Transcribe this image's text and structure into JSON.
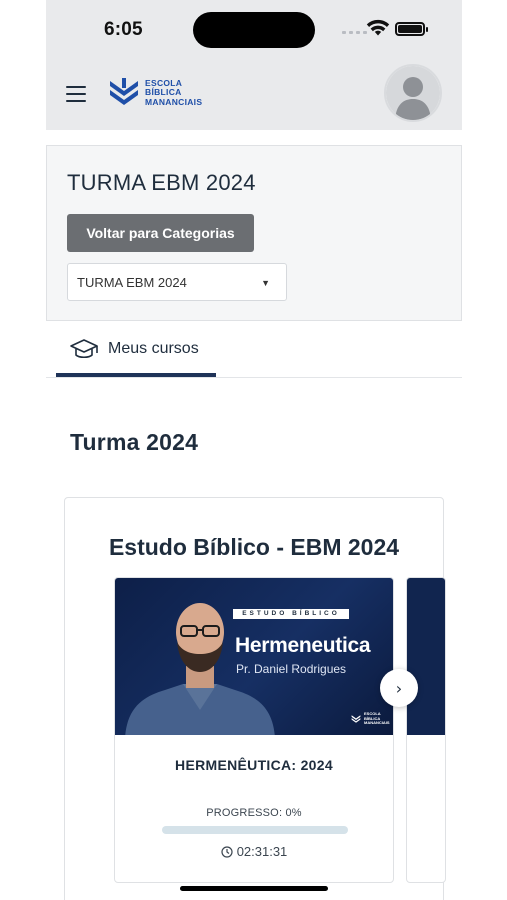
{
  "status_bar": {
    "time": "6:05"
  },
  "header": {
    "menu_icon": "hamburger-menu-icon",
    "logo": {
      "line1": "ESCOLA",
      "line2": "BÍBLICA",
      "line3": "MANANCIAIS",
      "color": "#1f4fa8"
    },
    "avatar_icon": "user-avatar-icon"
  },
  "category": {
    "title": "TURMA EBM 2024",
    "back_button": "Voltar para Categorias",
    "select_value": "TURMA EBM 2024",
    "select_caret": "▼"
  },
  "tabs": [
    {
      "label": "Meus cursos",
      "icon": "graduation-cap-icon",
      "active": true
    }
  ],
  "section": {
    "title": "Turma 2024"
  },
  "course": {
    "title": "Estudo Bíblico - EBM 2024",
    "items": [
      {
        "thumbnail": {
          "banner": "ESTUDO BÍBLICO",
          "title": "Hermeneutica",
          "subtitle": "Pr. Daniel Rodrigues",
          "badge": [
            "ESCOLA",
            "BÍBLICA",
            "MANANCIAIS"
          ]
        },
        "name": "HERMENÊUTICA: 2024",
        "progress_label": "PROGRESSO: 0%",
        "progress": 0,
        "duration": "02:31:31"
      }
    ],
    "next_icon": "chevron-right-icon",
    "next_glyph": "›"
  },
  "colors": {
    "accent": "#1f3358",
    "button_gray": "#6b6e72",
    "header_bg": "#e9eaec",
    "thumb_bg": "#0d1f48"
  }
}
